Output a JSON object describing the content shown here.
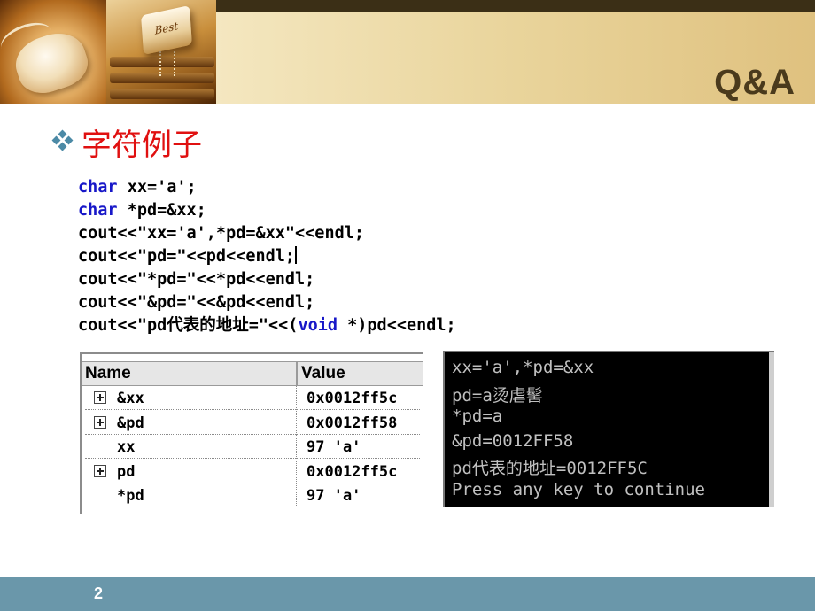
{
  "header": {
    "title": "Q&A",
    "key_label": "Best"
  },
  "bullet": {
    "icon": "diamond-bullet-icon",
    "text": "字符例子"
  },
  "code_lines": [
    "char xx='a';",
    "char *pd=&xx;",
    "cout<<\"xx='a',*pd=&xx\"<<endl;",
    "cout<<\"pd=\"<<pd<<endl;",
    "cout<<\"*pd=\"<<*pd<<endl;",
    "cout<<\"&pd=\"<<&pd<<endl;",
    "cout<<\"pd代表的地址=\"<<(void *)pd<<endl;"
  ],
  "watch": {
    "columns": {
      "name": "Name",
      "value": "Value"
    },
    "rows": [
      {
        "name": "&xx",
        "value": "0x0012ff5c",
        "expandable": true
      },
      {
        "name": "&pd",
        "value": "0x0012ff58",
        "expandable": true
      },
      {
        "name": "xx",
        "value": "97 'a'",
        "expandable": false
      },
      {
        "name": "pd",
        "value": "0x0012ff5c",
        "expandable": true
      },
      {
        "name": "*pd",
        "value": "97 'a'",
        "expandable": false
      }
    ]
  },
  "console": {
    "lines": [
      "xx='a',*pd=&xx",
      "pd=a烫虐髺",
      "*pd=a",
      "&pd=0012FF58",
      "pd代表的地址=0012FF5C",
      "Press any key to continue"
    ]
  },
  "footer": {
    "page_number": "2"
  },
  "colors": {
    "heading": "#e01010",
    "keyword": "#1717c8",
    "footer": "#6a97aa",
    "title": "#4a3a1c"
  }
}
